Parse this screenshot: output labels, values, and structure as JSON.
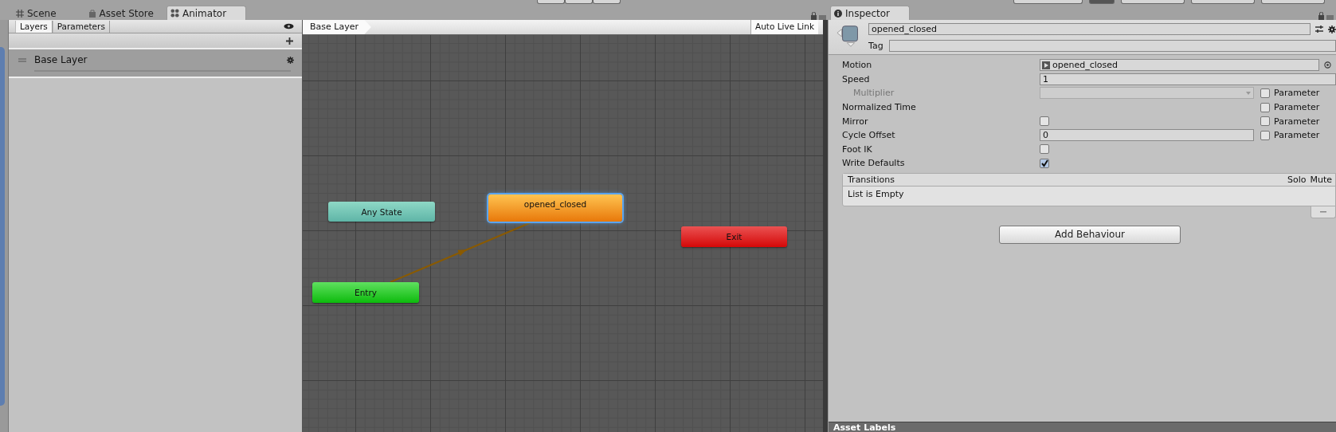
{
  "editor_tabs": [
    {
      "label": "Scene",
      "selected": false
    },
    {
      "label": "Asset Store",
      "selected": false
    },
    {
      "label": "Animator",
      "selected": true
    }
  ],
  "animator": {
    "panel_tabs": [
      {
        "label": "Layers",
        "selected": true
      },
      {
        "label": "Parameters",
        "selected": false
      }
    ],
    "layers": [
      {
        "name": "Base Layer"
      }
    ],
    "breadcrumb": "Base Layer",
    "live_link_button": "Auto Live Link",
    "nodes": [
      {
        "label": "Any State",
        "kind": "any",
        "selected": false
      },
      {
        "label": "opened_closed",
        "kind": "state",
        "selected": true
      },
      {
        "label": "Exit",
        "kind": "exit",
        "selected": false
      },
      {
        "label": "Entry",
        "kind": "entry",
        "selected": false
      }
    ]
  },
  "inspector": {
    "tab": "Inspector",
    "name": "opened_closed",
    "tag_label": "Tag",
    "properties": [
      {
        "label": "Motion",
        "kind": "object",
        "value": "opened_closed",
        "disabled": false
      },
      {
        "label": "Speed",
        "kind": "number",
        "value": "1",
        "disabled": false
      },
      {
        "label": "Multiplier",
        "kind": "dropdown",
        "disabled": true,
        "parameter": {
          "label": "Parameter",
          "checked": false
        }
      },
      {
        "label": "Normalized Time",
        "kind": "none",
        "disabled": false,
        "parameter": {
          "label": "Parameter",
          "checked": false
        }
      },
      {
        "label": "Mirror",
        "kind": "checkbox",
        "checked": false,
        "disabled": false,
        "parameter": {
          "label": "Parameter",
          "checked": false
        }
      },
      {
        "label": "Cycle Offset",
        "kind": "number",
        "value": "0",
        "disabled": false,
        "parameter": {
          "label": "Parameter",
          "checked": false
        }
      },
      {
        "label": "Foot IK",
        "kind": "checkbox",
        "checked": false,
        "disabled": false
      },
      {
        "label": "Write Defaults",
        "kind": "checkbox",
        "checked": true,
        "disabled": false
      }
    ],
    "transitions": {
      "title": "Transitions",
      "columns": [
        "Solo",
        "Mute"
      ],
      "empty_text": "List is Empty"
    },
    "add_button": "Add Behaviour",
    "footer": "Asset Labels"
  }
}
